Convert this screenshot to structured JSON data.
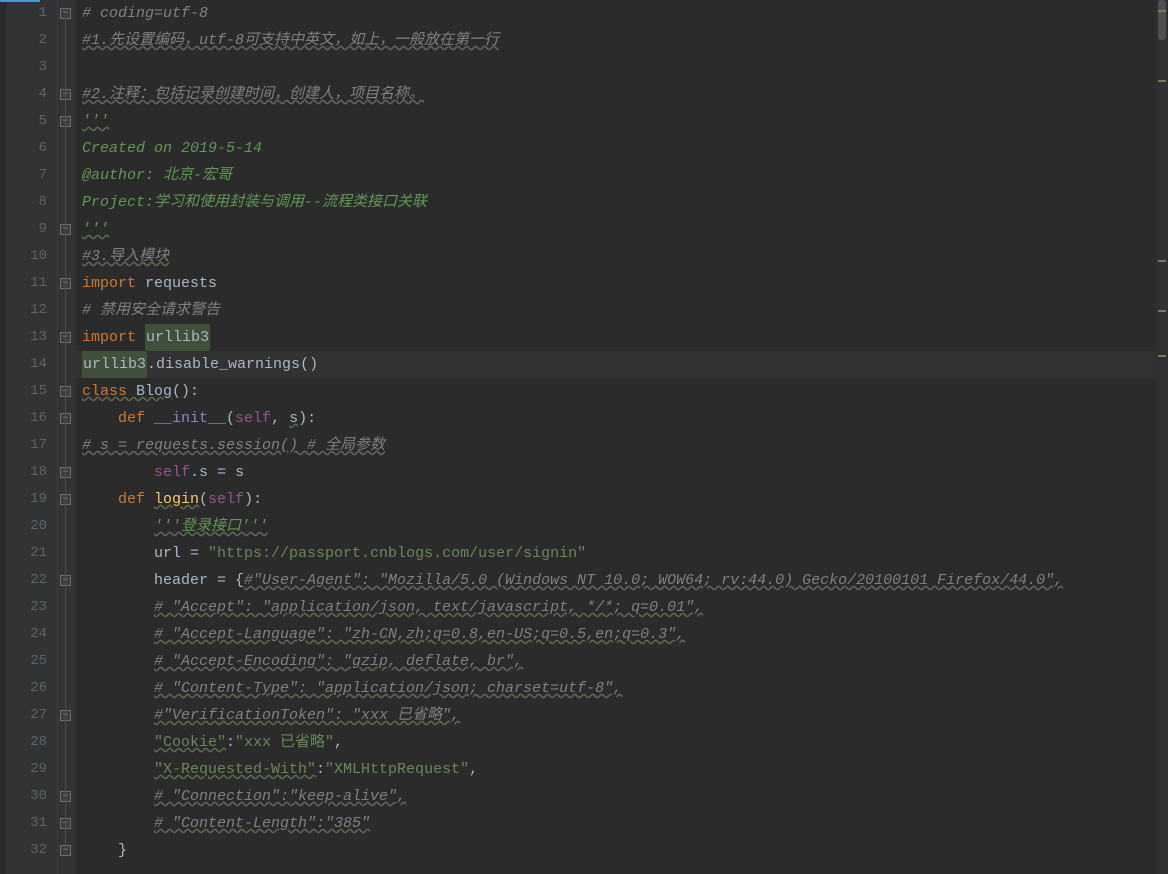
{
  "lines": [
    {
      "n": 1,
      "fold": "minus",
      "segs": [
        {
          "cls": "c-comment",
          "t": "# coding=utf-8"
        }
      ]
    },
    {
      "n": 2,
      "segs": [
        {
          "cls": "c-comment-wavy",
          "t": "#1.先设置编码，utf-8可支持中英文，如上，一般放在第一行"
        }
      ]
    },
    {
      "n": 3,
      "segs": []
    },
    {
      "n": 4,
      "fold": "minus",
      "segs": [
        {
          "cls": "c-comment-wavy",
          "t": "#2.注释：包括记录创建时间，创建人，项目名称。"
        }
      ]
    },
    {
      "n": 5,
      "fold": "minus",
      "segs": [
        {
          "cls": "c-docstring-wavy",
          "t": "'''"
        }
      ]
    },
    {
      "n": 6,
      "segs": [
        {
          "cls": "c-docstring",
          "t": "Created on 2019-5-14"
        }
      ]
    },
    {
      "n": 7,
      "segs": [
        {
          "cls": "c-docstring",
          "t": "@author: 北京-宏哥"
        }
      ]
    },
    {
      "n": 8,
      "segs": [
        {
          "cls": "c-docstring",
          "t": "Project:学习和使用封装与调用--流程类接口关联"
        }
      ]
    },
    {
      "n": 9,
      "fold": "end",
      "segs": [
        {
          "cls": "c-docstring-wavy",
          "t": "'''"
        }
      ]
    },
    {
      "n": 10,
      "segs": [
        {
          "cls": "c-comment-wavy",
          "t": "#3.导入模块"
        }
      ]
    },
    {
      "n": 11,
      "fold": "minus",
      "segs": [
        {
          "cls": "c-keyword",
          "t": "import "
        },
        {
          "cls": "c-ident",
          "t": "requests"
        }
      ]
    },
    {
      "n": 12,
      "segs": [
        {
          "cls": "c-comment",
          "t": "# 禁用安全请求警告"
        }
      ]
    },
    {
      "n": 13,
      "fold": "end",
      "segs": [
        {
          "cls": "c-keyword",
          "t": "import "
        },
        {
          "cls": "c-ident c-usage-hl",
          "t": "urllib3"
        }
      ]
    },
    {
      "n": 14,
      "current": true,
      "segs": [
        {
          "cls": "caret",
          "t": ""
        },
        {
          "cls": "c-ident c-usage-hl",
          "t": "urllib3"
        },
        {
          "cls": "c-op",
          "t": "."
        },
        {
          "cls": "c-ident",
          "t": "disable_warnings"
        },
        {
          "cls": "c-op",
          "t": "()"
        }
      ]
    },
    {
      "n": 15,
      "fold": "minus",
      "segs": [
        {
          "cls": "c-keyword-wavy",
          "t": "class "
        },
        {
          "cls": "c-ident-wavy",
          "t": "Blog"
        },
        {
          "cls": "c-op",
          "t": "():"
        }
      ]
    },
    {
      "n": 16,
      "fold": "minus",
      "indent": 1,
      "segs": [
        {
          "cls": "c-keyword",
          "t": "def "
        },
        {
          "cls": "c-builtin",
          "t": "__init__"
        },
        {
          "cls": "c-op",
          "t": "("
        },
        {
          "cls": "c-self",
          "t": "self"
        },
        {
          "cls": "c-op",
          "t": ", "
        },
        {
          "cls": "c-ident-wavy",
          "t": "s"
        },
        {
          "cls": "c-op",
          "t": "):"
        }
      ]
    },
    {
      "n": 17,
      "segs": [
        {
          "cls": "c-comment-wavy",
          "t": "# s = requests.session() # 全局参数"
        }
      ]
    },
    {
      "n": 18,
      "fold": "end",
      "indent": 2,
      "segs": [
        {
          "cls": "c-self",
          "t": "self"
        },
        {
          "cls": "c-op",
          "t": "."
        },
        {
          "cls": "c-ident",
          "t": "s"
        },
        {
          "cls": "c-op",
          "t": " = "
        },
        {
          "cls": "c-ident",
          "t": "s"
        }
      ]
    },
    {
      "n": 19,
      "fold": "minus",
      "indent": 1,
      "segs": [
        {
          "cls": "c-keyword",
          "t": "def "
        },
        {
          "cls": "c-func-wavy",
          "t": "login"
        },
        {
          "cls": "c-op",
          "t": "("
        },
        {
          "cls": "c-self",
          "t": "self"
        },
        {
          "cls": "c-op",
          "t": "):"
        }
      ]
    },
    {
      "n": 20,
      "indent": 2,
      "segs": [
        {
          "cls": "c-docstring-wavy",
          "t": "'''登录接口'''"
        }
      ]
    },
    {
      "n": 21,
      "indent": 2,
      "segs": [
        {
          "cls": "c-ident",
          "t": "url"
        },
        {
          "cls": "c-op",
          "t": " = "
        },
        {
          "cls": "c-string",
          "t": "\"https://passport.cnblogs.com/user/signin\""
        }
      ]
    },
    {
      "n": 22,
      "fold": "minus",
      "indent": 2,
      "segs": [
        {
          "cls": "c-ident",
          "t": "header"
        },
        {
          "cls": "c-op",
          "t": " = {"
        },
        {
          "cls": "c-comment-wavy",
          "t": "#\"User-Agent\": \"Mozilla/5.0 (Windows NT 10.0; WOW64; rv:44.0) Gecko/20100101 Firefox/44.0\","
        }
      ]
    },
    {
      "n": 23,
      "indent": 2,
      "segs": [
        {
          "cls": "c-comment-wavy",
          "t": "# \"Accept\": \"application/json, text/javascript, */*; q=0.01\","
        }
      ]
    },
    {
      "n": 24,
      "indent": 2,
      "segs": [
        {
          "cls": "c-comment-wavy",
          "t": "# \"Accept-Language\": \"zh-CN,zh;q=0.8,en-US;q=0.5,en;q=0.3\","
        }
      ]
    },
    {
      "n": 25,
      "indent": 2,
      "segs": [
        {
          "cls": "c-comment-wavy",
          "t": "# \"Accept-Encoding\": \"gzip, deflate, br\","
        }
      ]
    },
    {
      "n": 26,
      "indent": 2,
      "segs": [
        {
          "cls": "c-comment-wavy",
          "t": "# \"Content-Type\": \"application/json; charset=utf-8\","
        }
      ]
    },
    {
      "n": 27,
      "fold": "end",
      "indent": 2,
      "segs": [
        {
          "cls": "c-comment-wavy",
          "t": "#\"VerificationToken\": \"xxx 已省略\","
        }
      ]
    },
    {
      "n": 28,
      "indent": 2,
      "segs": [
        {
          "cls": "c-string-wavy",
          "t": "\"Cookie\""
        },
        {
          "cls": "c-op",
          "t": ":"
        },
        {
          "cls": "c-string",
          "t": "\"xxx 已省略\""
        },
        {
          "cls": "c-op",
          "t": ","
        }
      ]
    },
    {
      "n": 29,
      "indent": 2,
      "segs": [
        {
          "cls": "c-string-wavy",
          "t": "\"X-Requested-With\""
        },
        {
          "cls": "c-op",
          "t": ":"
        },
        {
          "cls": "c-string",
          "t": "\"XMLHttpRequest\""
        },
        {
          "cls": "c-op",
          "t": ","
        }
      ]
    },
    {
      "n": 30,
      "fold": "minus",
      "indent": 2,
      "segs": [
        {
          "cls": "c-comment-wavy",
          "t": "# \"Connection\":\"keep-alive\","
        }
      ]
    },
    {
      "n": 31,
      "fold": "end",
      "indent": 2,
      "segs": [
        {
          "cls": "c-comment-wavy",
          "t": "# \"Content-Length\":\"385\""
        }
      ]
    },
    {
      "n": 32,
      "fold": "end",
      "indent": 1,
      "segs": [
        {
          "cls": "c-op",
          "t": "}"
        }
      ]
    }
  ],
  "lineHeight": 27,
  "currentLine": 14
}
